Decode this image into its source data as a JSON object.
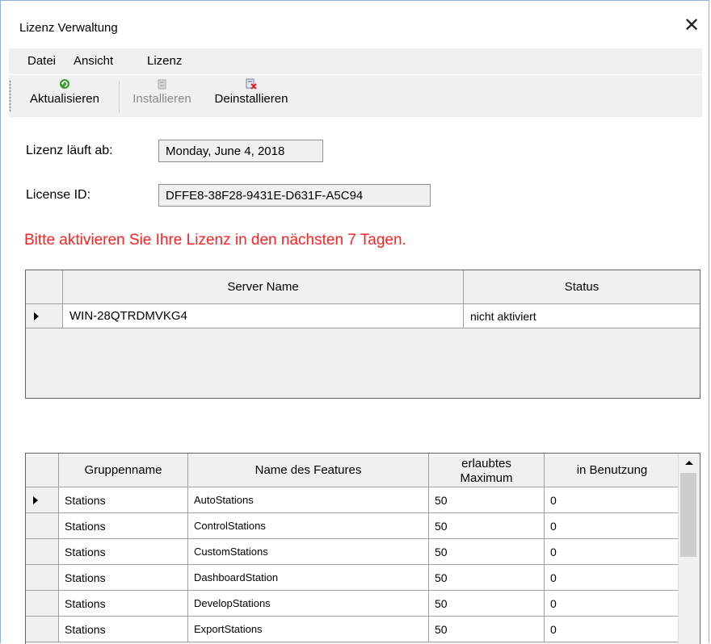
{
  "window": {
    "title": "Lizenz Verwaltung",
    "close_glyph": "✕"
  },
  "menu": [
    "Datei",
    "Ansicht",
    "Lizenz"
  ],
  "toolbar": {
    "refresh_label": "Aktualisieren",
    "install_label": "Installieren",
    "uninstall_label": "Deinstallieren",
    "icons": {
      "refresh": "refresh-icon",
      "install": "install-icon",
      "uninstall": "uninstall-icon"
    }
  },
  "license": {
    "expires_label": "Lizenz läuft ab:",
    "expires_value": "Monday, June 4, 2018",
    "id_label": "License ID:",
    "id_value": "DFFE8-38F28-9431E-D631F-A5C94"
  },
  "warning": {
    "text": "Bitte aktivieren Sie Ihre Lizenz in den nächsten 7 Tagen.",
    "color": "#ff2020"
  },
  "servers": {
    "columns": [
      "Server Name",
      "Status"
    ],
    "rows": [
      {
        "name": "WIN-28QTRDMVKG4",
        "status": "nicht aktiviert"
      }
    ]
  },
  "features": {
    "columns": [
      "Gruppenname",
      "Name des Features",
      "erlaubtes Maximum",
      "in Benutzung"
    ],
    "rows": [
      {
        "group": "Stations",
        "feature": "AutoStations",
        "max": "50",
        "used": "0"
      },
      {
        "group": "Stations",
        "feature": "ControlStations",
        "max": "50",
        "used": "0"
      },
      {
        "group": "Stations",
        "feature": "CustomStations",
        "max": "50",
        "used": "0"
      },
      {
        "group": "Stations",
        "feature": "DashboardStation",
        "max": "50",
        "used": "0"
      },
      {
        "group": "Stations",
        "feature": "DevelopStations",
        "max": "50",
        "used": "0"
      },
      {
        "group": "Stations",
        "feature": "ExportStations",
        "max": "50",
        "used": "0"
      }
    ]
  }
}
